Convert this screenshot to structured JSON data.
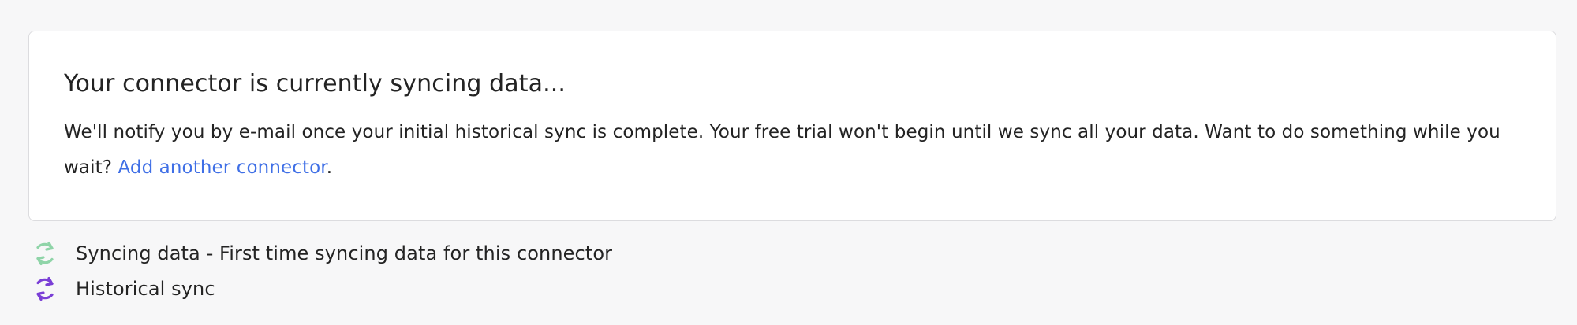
{
  "card": {
    "title": "Your connector is currently syncing data...",
    "body_text": "We'll notify you by e-mail once your initial historical sync is complete. Your free trial won't begin until we sync all your data. Want to do something while you wait? ",
    "link_label": "Add another connector",
    "body_end": "."
  },
  "status": {
    "items": [
      {
        "icon": "sync-icon",
        "icon_color": "#8fd4a8",
        "label": "Syncing data - First time syncing data for this connector"
      },
      {
        "icon": "sync-icon",
        "icon_color": "#7a3fd6",
        "label": "Historical sync"
      }
    ]
  },
  "colors": {
    "link": "#3f6fe6",
    "background": "#f7f7f8",
    "card_border": "#dcdcdf"
  }
}
